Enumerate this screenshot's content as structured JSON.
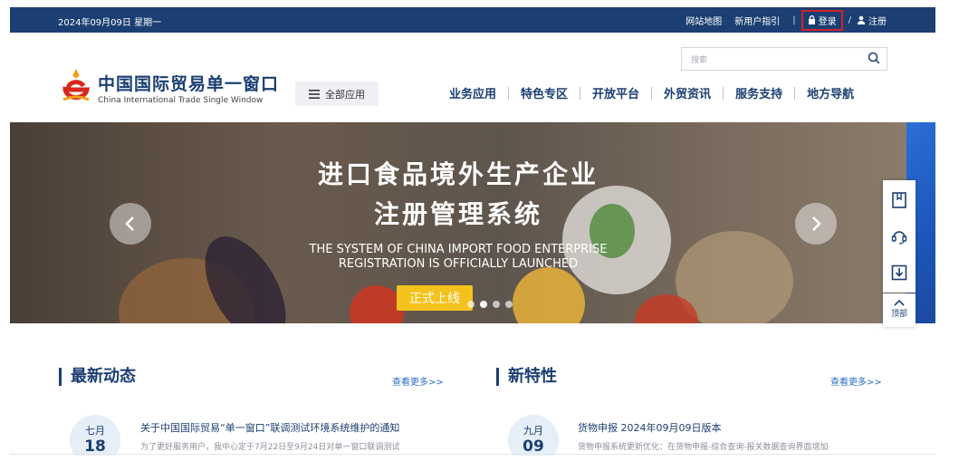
{
  "topbar": {
    "date": "2024年09月09日 星期一",
    "links": [
      "网站地图",
      "新用户指引"
    ],
    "separator": "|",
    "login": "登录",
    "slash": "/",
    "register": "注册"
  },
  "header": {
    "brand_cn": "中国国际贸易单一窗口",
    "brand_en": "China International Trade Single Window",
    "all_apps": "全部应用",
    "search_placeholder": "搜索",
    "nav": [
      "业务应用",
      "特色专区",
      "开放平台",
      "外贸资讯",
      "服务支持",
      "地方导航"
    ]
  },
  "banner": {
    "title_line1": "进口食品境外生产企业",
    "title_line2": "注册管理系统",
    "en_line1": "THE SYSTEM OF CHINA IMPORT FOOD ENTERPRISE",
    "en_line2": "REGISTRATION IS OFFICIALLY LAUNCHED",
    "button": "正式上线",
    "slide_count": 4,
    "active_slide": 1
  },
  "sidebar": {
    "top_label": "顶部"
  },
  "sections": {
    "latest": {
      "title": "最新动态",
      "more": "查看更多>>",
      "item": {
        "month": "七月",
        "day": "18",
        "title": "关于中国国际贸易“单一窗口”联调测试环境系统维护的通知",
        "summary": "为了更好服务用户，我中心定于7月22日至9月24日对单一窗口联调测试"
      }
    },
    "features": {
      "title": "新特性",
      "more": "查看更多>>",
      "item": {
        "month": "九月",
        "day": "09",
        "title": "货物申报 2024年09月09日版本",
        "summary": "货物申报系统更新优化：在货物申报-综合查询-报关数据查询界面增加"
      }
    }
  },
  "colors": {
    "navy": "#1b3f72",
    "login_highlight": "#d2222d",
    "button_yellow": "#f4c21c",
    "link_blue": "#2a6cc4"
  }
}
